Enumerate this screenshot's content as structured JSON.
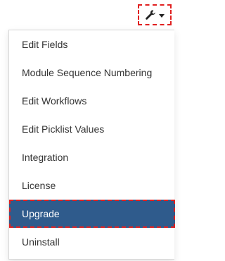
{
  "toolbar": {
    "settings_icon": "wrench-icon",
    "dropdown_icon": "caret-down-icon",
    "highlight_color": "#e02020"
  },
  "menu": {
    "items": [
      {
        "label": "Edit Fields"
      },
      {
        "label": "Module Sequence Numbering"
      },
      {
        "label": "Edit Workflows"
      },
      {
        "label": "Edit Picklist Values"
      },
      {
        "label": "Integration"
      },
      {
        "label": "License"
      },
      {
        "label": "Upgrade",
        "active": true
      },
      {
        "label": "Uninstall"
      }
    ],
    "active_background": "#2f5b8c"
  }
}
